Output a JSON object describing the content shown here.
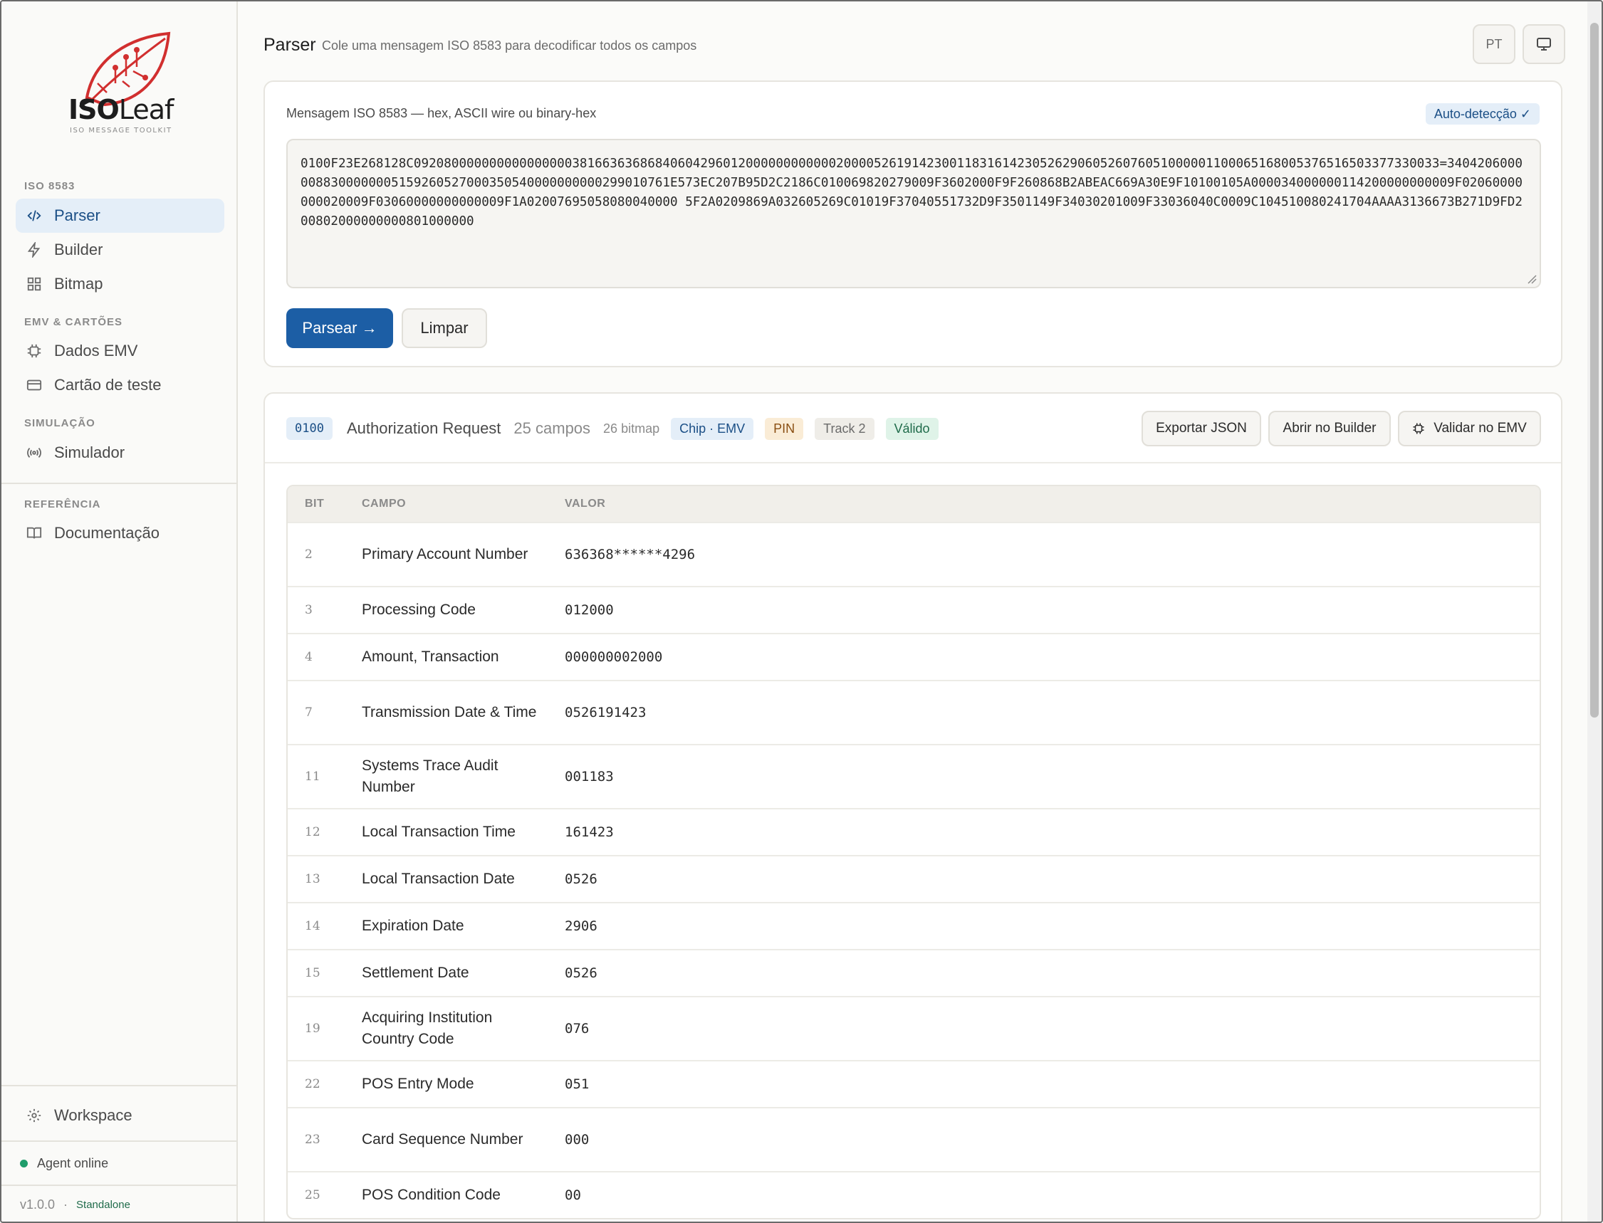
{
  "brand": {
    "word_bold": "ISO",
    "word_light": "Leaf",
    "subtitle": "ISO MESSAGE TOOLKIT"
  },
  "sidebar": {
    "sections": [
      {
        "label": "ISO 8583"
      },
      {
        "label": "EMV & CARTÕES"
      },
      {
        "label": "SIMULAÇÃO"
      },
      {
        "label": "REFERÊNCIA"
      }
    ],
    "items": [
      {
        "label": "Parser",
        "icon": "code-icon",
        "active": true
      },
      {
        "label": "Builder",
        "icon": "bolt-icon"
      },
      {
        "label": "Bitmap",
        "icon": "grid-icon"
      },
      {
        "label": "Dados EMV",
        "icon": "chip-icon"
      },
      {
        "label": "Cartão de teste",
        "icon": "card-icon"
      },
      {
        "label": "Simulador",
        "icon": "broadcast-icon"
      },
      {
        "label": "Documentação",
        "icon": "book-icon"
      }
    ],
    "workspace": {
      "label": "Workspace",
      "icon": "gear-icon"
    },
    "agent_status": "Agent online",
    "version": "v1.0.0",
    "version_sep": "·",
    "mode": "Standalone"
  },
  "header": {
    "title": "Parser",
    "subtitle": "Cole uma mensagem ISO 8583 para decodificar todos os campos",
    "lang_button": "PT",
    "theme_icon": "monitor-icon"
  },
  "input_card": {
    "label": "Mensagem ISO 8583 — hex, ASCII wire ou binary-hex",
    "auto_badge": "Auto-detecção ✓",
    "message": "0100F23E268128C0920800000000000000003816636368684060429601200000000000020000526191423001183161423052629060526076051000001100065168005376516503377330033=34042060000088300000005159260527000350540000000000299010761E573EC207B95D2C2186C010069820279009F3602000F9F260868B2ABEAC669A30E9F10100105A000034000000114200000000009F02060000000020009F03060000000000009F1A02007695058080040000 5F2A0209869A032605269C01019F37040551732D9F3501149F34030201009F33036040C0009C104510080241704AAAA3136673B271D9FD200802000000000801000000",
    "parse_button": "Parsear →",
    "clear_button": "Limpar"
  },
  "result": {
    "mti": "0100",
    "mti_name": "Authorization Request",
    "field_count": "25 campos",
    "bitmap_count": "26 bitmap",
    "tags": [
      {
        "label": "Chip · EMV",
        "kind": "chip"
      },
      {
        "label": "PIN",
        "kind": "pin"
      },
      {
        "label": "Track 2",
        "kind": "track"
      },
      {
        "label": "Válido",
        "kind": "valid"
      }
    ],
    "actions": {
      "export": "Exportar JSON",
      "open_builder": "Abrir no Builder",
      "validate_emv": "Validar no EMV"
    },
    "columns": {
      "bit": "BIT",
      "field": "CAMPO",
      "value": "VALOR"
    },
    "rows": [
      {
        "bit": "2",
        "name": "Primary Account Number",
        "value": "636368******4296"
      },
      {
        "bit": "3",
        "name": "Processing Code",
        "value": "012000"
      },
      {
        "bit": "4",
        "name": "Amount, Transaction",
        "value": "000000002000"
      },
      {
        "bit": "7",
        "name": "Transmission Date & Time",
        "value": "0526191423"
      },
      {
        "bit": "11",
        "name": "Systems Trace Audit Number",
        "value": "001183"
      },
      {
        "bit": "12",
        "name": "Local Transaction Time",
        "value": "161423"
      },
      {
        "bit": "13",
        "name": "Local Transaction Date",
        "value": "0526"
      },
      {
        "bit": "14",
        "name": "Expiration Date",
        "value": "2906"
      },
      {
        "bit": "15",
        "name": "Settlement Date",
        "value": "0526"
      },
      {
        "bit": "19",
        "name": "Acquiring Institution Country Code",
        "value": "076"
      },
      {
        "bit": "22",
        "name": "POS Entry Mode",
        "value": "051"
      },
      {
        "bit": "23",
        "name": "Card Sequence Number",
        "value": "000"
      },
      {
        "bit": "25",
        "name": "POS Condition Code",
        "value": "00"
      }
    ]
  },
  "colors": {
    "accent": "#1c5ea5",
    "active_bg": "#e4eef8",
    "online": "#1f9d6b",
    "logo_red": "#d12f2f"
  }
}
